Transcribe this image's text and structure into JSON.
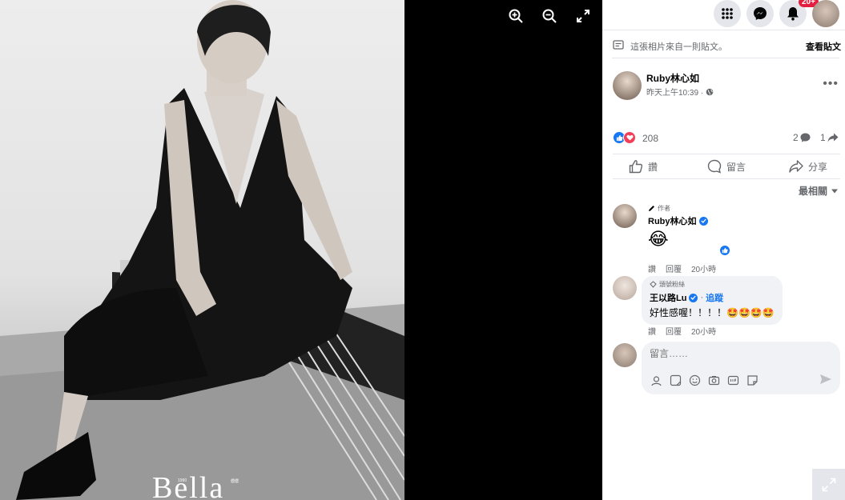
{
  "viewer": {
    "brand": "Bella",
    "brand_small_left": "1990",
    "brand_small_right": "儂儂",
    "tools": [
      "zoom-in-icon",
      "zoom-out-icon",
      "fullscreen-icon"
    ]
  },
  "topbar": {
    "notif_badge": "20+",
    "icons": [
      "grid-icon",
      "messenger-icon",
      "bell-icon"
    ]
  },
  "source": {
    "text": "這張相片來自一則貼文。",
    "link": "查看貼文"
  },
  "post": {
    "author": "Ruby林心如",
    "time": "昨天上午10:39 ·",
    "reactions_count": "208",
    "comments_count": "2",
    "shares_count": "1",
    "actions": {
      "like": "讚",
      "comment": "留言",
      "share": "分享"
    },
    "sort_label": "最相關"
  },
  "comments": [
    {
      "tag": "作者",
      "name": "Ruby林心如",
      "emoji": "😂",
      "like_label": "讚",
      "reply_label": "回覆",
      "time": "20小時"
    },
    {
      "tag": "頭號粉絲",
      "name": "王以路Lu",
      "follow": "追蹤",
      "text": "好性感喔！！！！🤩🤩🤩🤩",
      "like_label": "讚",
      "reply_label": "回覆",
      "time": "20小時"
    }
  ],
  "compose": {
    "placeholder": "留言……"
  },
  "colors": {
    "accent": "#1877f2",
    "love": "#f33e58",
    "badge": "#e41e3f"
  }
}
